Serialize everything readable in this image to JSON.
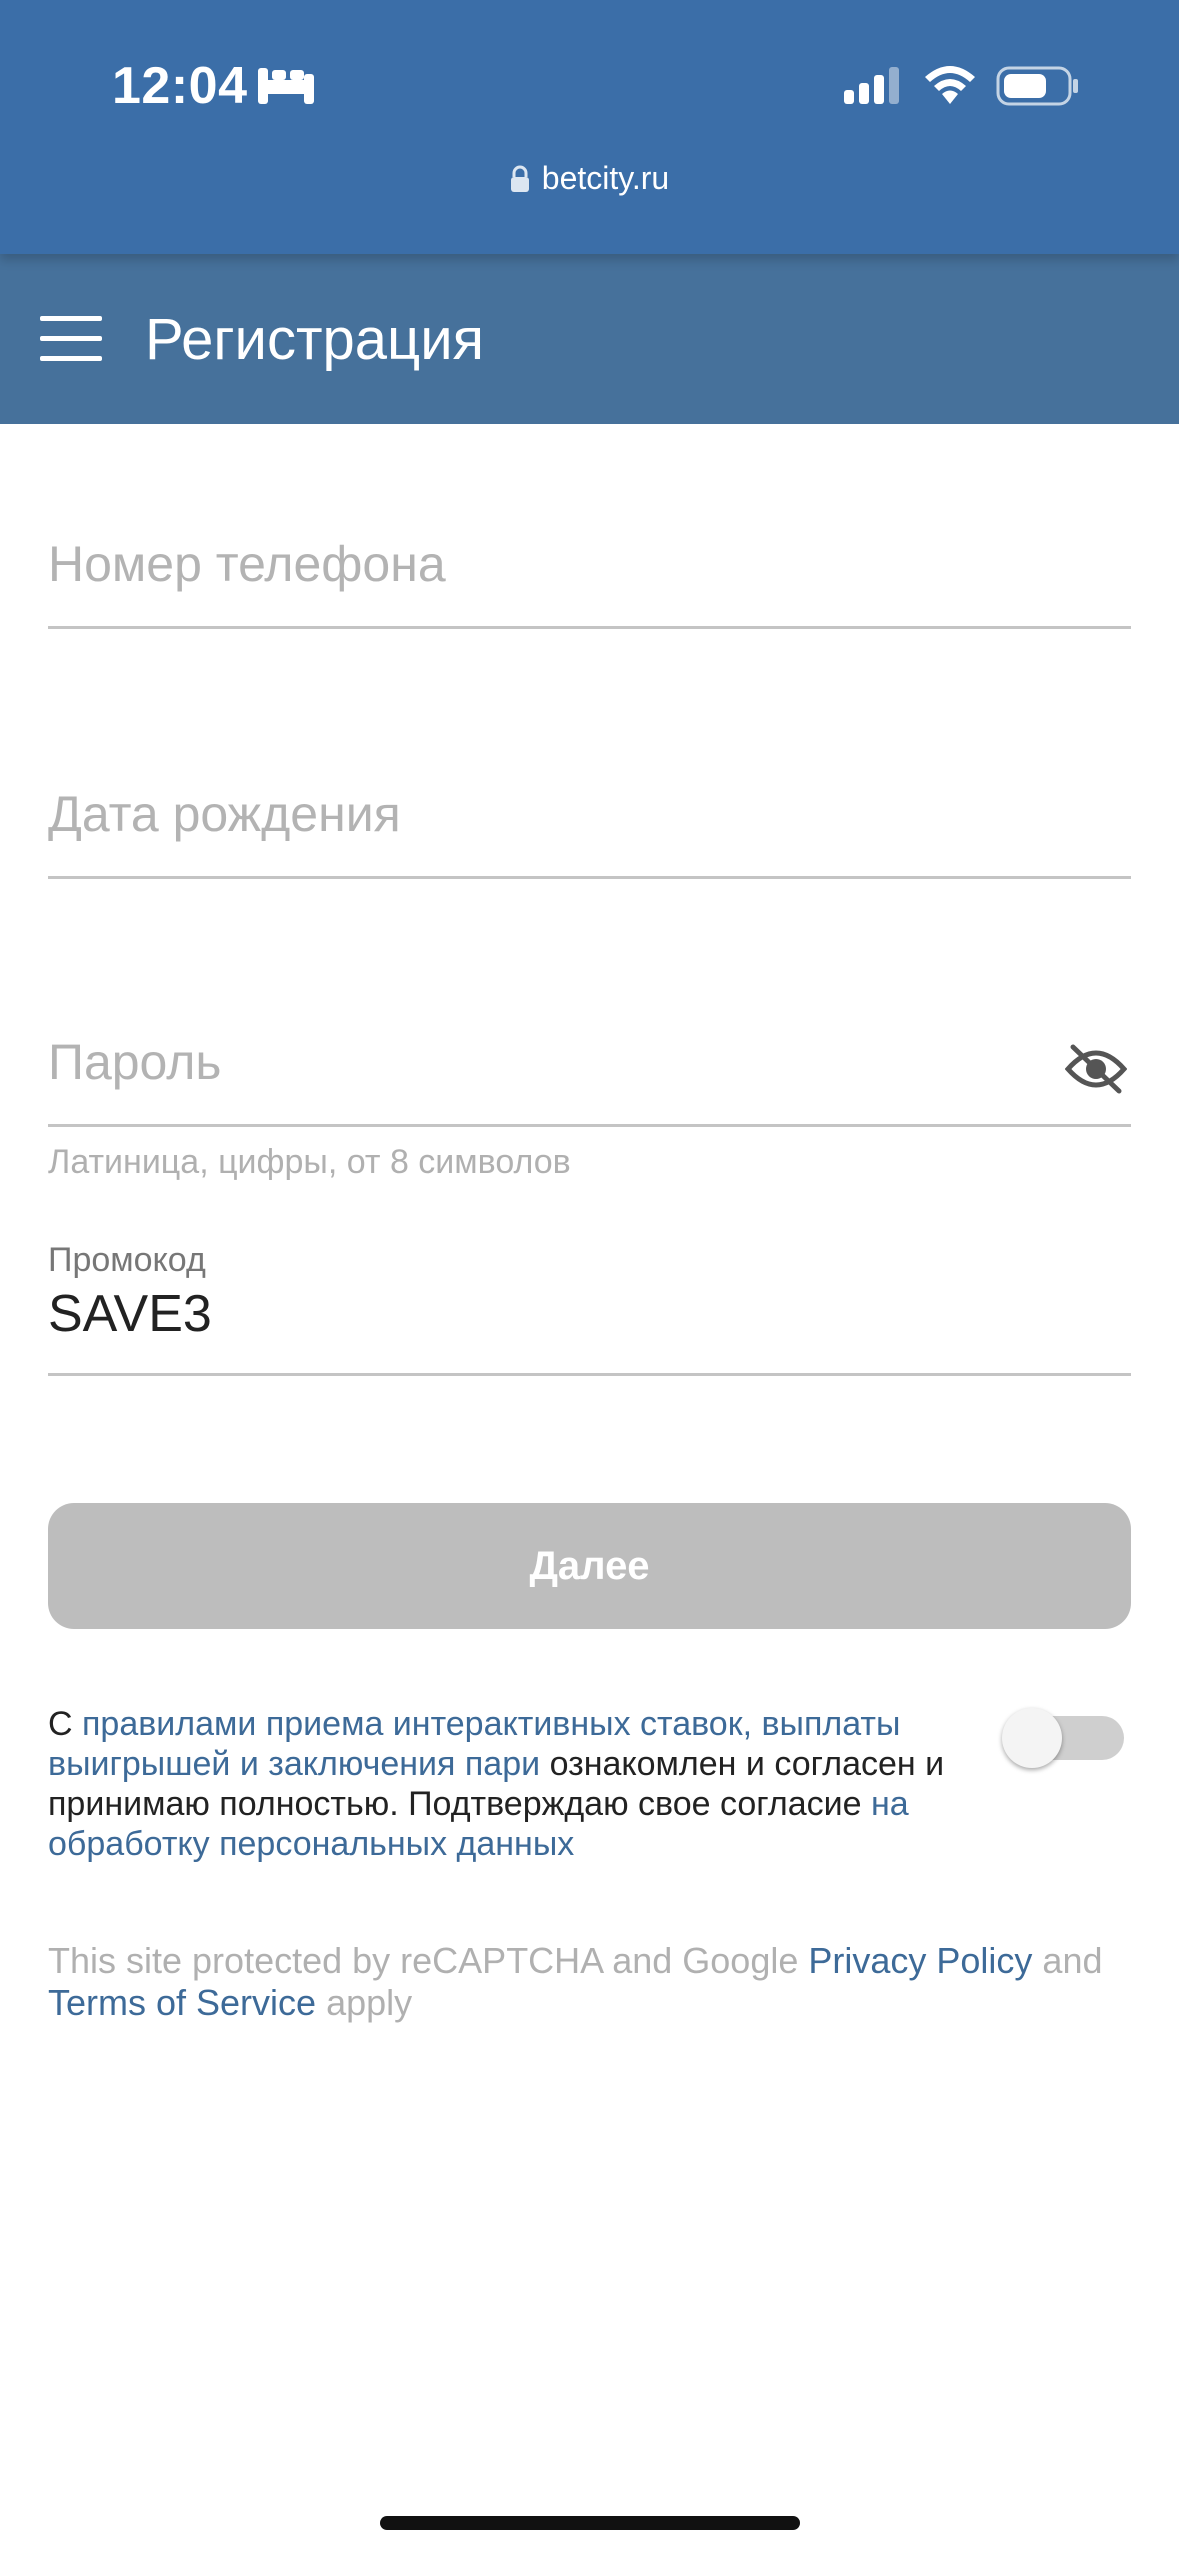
{
  "status_bar": {
    "time": "12:04",
    "url": "betcity.ru"
  },
  "header": {
    "title": "Регистрация"
  },
  "form": {
    "phone_placeholder": "Номер телефона",
    "birth_placeholder": "Дата рождения",
    "password_placeholder": "Пароль",
    "password_hint": "Латиница, цифры, от 8 символов",
    "promo_label": "Промокод",
    "promo_value": "SAVE3",
    "next_button": "Далее"
  },
  "consent": {
    "prefix": "С ",
    "rules_link": "правилами приема интерактивных ставок, выплаты выигрышей и заключения пари",
    "middle": " ознакомлен и согласен и принимаю полностью. Подтверждаю свое согласие ",
    "data_link": "на обработку персональных данных",
    "toggle_on": false
  },
  "recaptcha": {
    "prefix": "This site protected by reCAPTCHA and Google ",
    "privacy_link": "Privacy Policy",
    "middle": " and ",
    "terms_link": "Terms of Service",
    "suffix": " apply"
  },
  "colors": {
    "status_bg": "#3b6ea8",
    "header_bg": "#46719b",
    "link": "#3d6a98",
    "button_disabled": "#bdbdbd"
  },
  "icons": [
    "sleep-icon",
    "signal-icon",
    "wifi-icon",
    "battery-icon",
    "lock-icon",
    "menu-icon",
    "eye-off-icon"
  ]
}
